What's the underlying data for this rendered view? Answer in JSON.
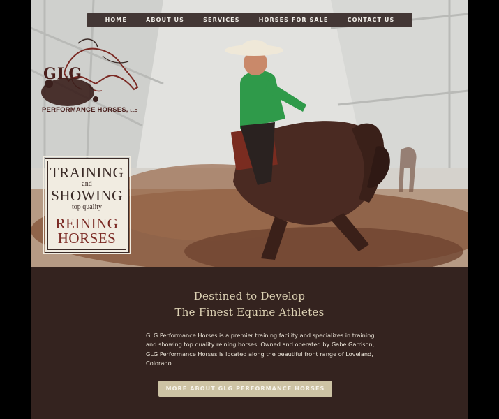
{
  "nav": {
    "items": [
      {
        "label": "HOME"
      },
      {
        "label": "ABOUT US"
      },
      {
        "label": "SERVICES"
      },
      {
        "label": "HORSES FOR SALE"
      },
      {
        "label": "CONTACT US"
      }
    ]
  },
  "logo": {
    "name": "GLG",
    "subtitle": "PERFORMANCE HORSES",
    "suffix": "LLC"
  },
  "sign": {
    "line1": "TRAINING",
    "line2": "and",
    "line3": "SHOWING",
    "line4": "top quality",
    "line5": "REINING",
    "line6": "HORSES"
  },
  "main": {
    "headline_1": "Destined to Develop",
    "headline_2": "The Finest Equine Athletes",
    "body": "GLG Performance Horses is a premier training facility and specializes in training and showing top quality reining horses. Owned and operated by Gabe Garrison, GLG Performance Horses is located along the beautiful front range of Loveland, Colorado.",
    "cta_label": "MORE ABOUT GLG PERFORMANCE HORSES"
  },
  "colors": {
    "nav_bg": "#433735",
    "content_bg": "#34231f",
    "headline": "#dcd1b3",
    "cta_bg": "#cdc3a4",
    "brand_red": "#7b2a24"
  }
}
